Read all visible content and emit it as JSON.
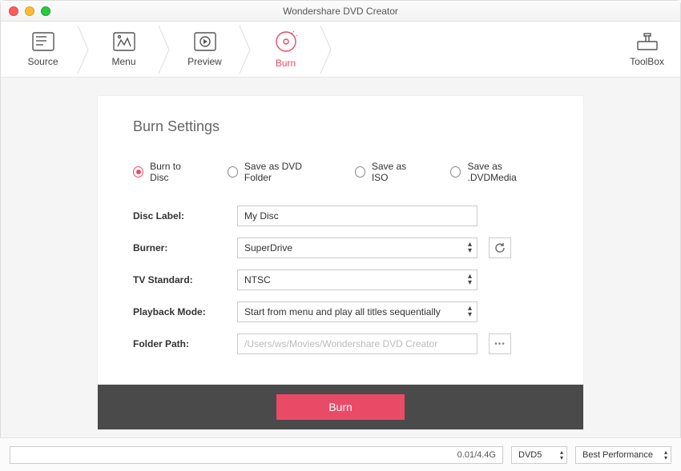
{
  "window": {
    "title": "Wondershare DVD Creator"
  },
  "nav": {
    "steps": [
      {
        "label": "Source"
      },
      {
        "label": "Menu"
      },
      {
        "label": "Preview"
      },
      {
        "label": "Burn"
      }
    ],
    "toolbox_label": "ToolBox"
  },
  "panel": {
    "title": "Burn Settings",
    "radios": {
      "burn_to_disc": "Burn to Disc",
      "save_dvd_folder": "Save as DVD Folder",
      "save_iso": "Save as ISO",
      "save_dvdmedia": "Save as .DVDMedia"
    },
    "labels": {
      "disc_label": "Disc Label:",
      "burner": "Burner:",
      "tv_standard": "TV Standard:",
      "playback_mode": "Playback Mode:",
      "folder_path": "Folder Path:"
    },
    "values": {
      "disc_label": "My Disc",
      "burner": "SuperDrive",
      "tv_standard": "NTSC",
      "playback_mode": "Start from menu and play all titles sequentially",
      "folder_path": "/Users/ws/Movies/Wondershare DVD Creator"
    },
    "burn_button": "Burn"
  },
  "bottom": {
    "capacity": "0.01/4.4G",
    "disc_type": "DVD5",
    "quality": "Best Performance"
  }
}
